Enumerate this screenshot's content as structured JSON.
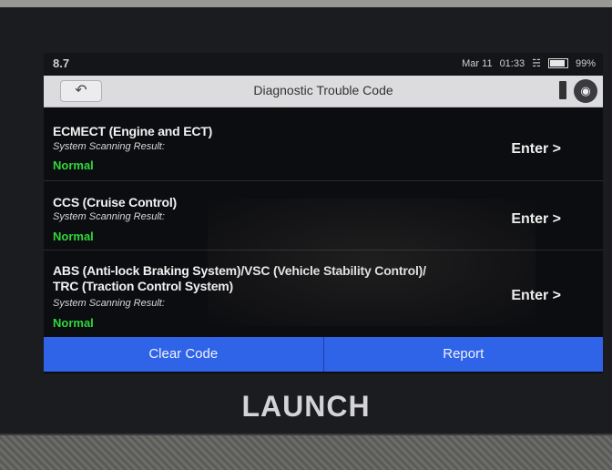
{
  "status_bar": {
    "left_text": "8.7",
    "date": "Mar 11",
    "time": "01:33",
    "battery": "99%"
  },
  "title_bar": {
    "title": "Diagnostic Trouble Code",
    "back_icon": "back-arrow-icon",
    "right_icons": [
      "flag-icon",
      "camera-icon"
    ]
  },
  "systems": [
    {
      "name_line1": "ECMECT (Engine and ECT)",
      "name_line2": "",
      "result_label": "System Scanning Result:",
      "status": "Normal",
      "action": "Enter >"
    },
    {
      "name_line1": "CCS (Cruise Control)",
      "name_line2": "",
      "result_label": "System Scanning Result:",
      "status": "Normal",
      "action": "Enter >"
    },
    {
      "name_line1": "ABS (Anti-lock Braking System)/VSC (Vehicle Stability Control)/",
      "name_line2": "TRC (Traction Control System)",
      "result_label": "System Scanning Result:",
      "status": "Normal",
      "action": "Enter >"
    }
  ],
  "bottom_buttons": {
    "clear": "Clear Code",
    "report": "Report"
  },
  "brand": "LAUNCH",
  "colors": {
    "status_normal": "#2fd63a",
    "button_blue": "#2f63e8",
    "title_bar": "#dcdcde"
  }
}
